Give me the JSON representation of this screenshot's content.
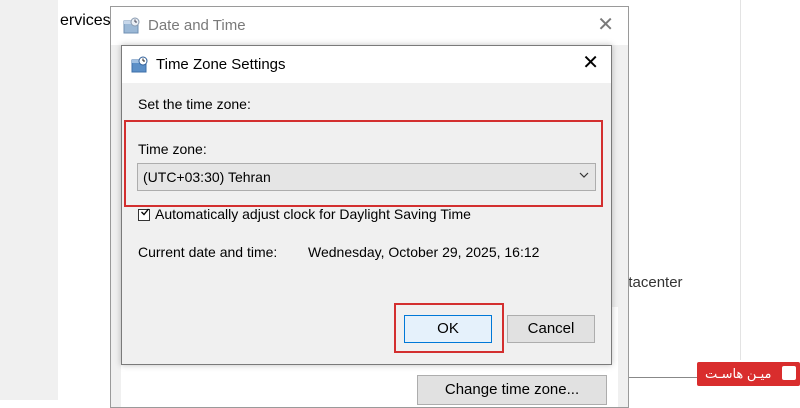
{
  "background": {
    "services_label": "ervices",
    "datacenter_label": "atacenter"
  },
  "outer_dialog": {
    "title": "Date and Time",
    "close_glyph": "✕",
    "change_time_zone_button": "Change time zone..."
  },
  "tz_dialog": {
    "title": "Time Zone Settings",
    "close_glyph": "✕",
    "set_time_zone_label": "Set the time zone:",
    "time_zone_label": "Time zone:",
    "time_zone_value": "(UTC+03:30) Tehran",
    "dst_checkbox_label": "Automatically adjust clock for Daylight Saving Time",
    "dst_checked": true,
    "current_label": "Current date and time:",
    "current_value": "Wednesday, October 29, 2025, 16:12",
    "ok_button": "OK",
    "cancel_button": "Cancel"
  },
  "watermark": {
    "text": "میـن هاسـت"
  },
  "colors": {
    "highlight": "#d32f2f",
    "dialog_bg": "#f0f0f0",
    "ok_border": "#0078d7",
    "logo_bg": "#d92d2d"
  },
  "icons": {
    "dialog": "date-time-icon",
    "dropdown": "chevron-down-icon",
    "close": "close-icon",
    "check": "checkmark-icon"
  }
}
